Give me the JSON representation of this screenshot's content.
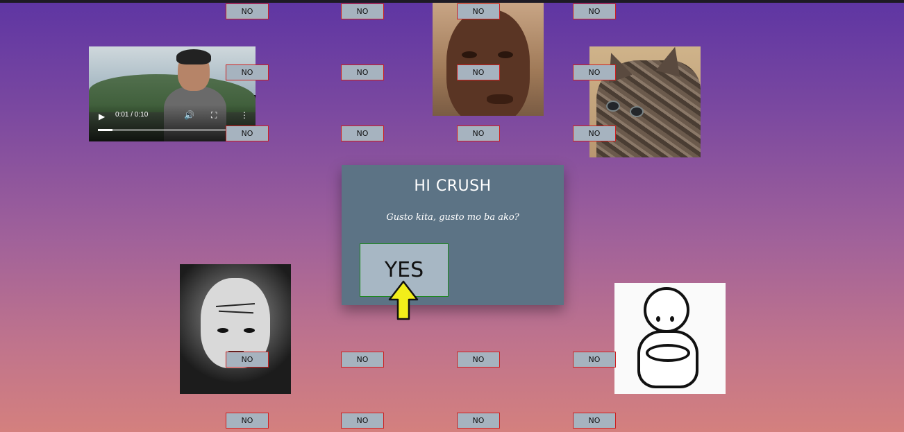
{
  "dialog": {
    "title": "HI CRUSH",
    "subtitle": "Gusto kita, gusto mo ba ako?",
    "yes_label": "YES"
  },
  "no_buttons": [
    {
      "label": "NO"
    },
    {
      "label": "NO"
    },
    {
      "label": "NO"
    },
    {
      "label": "NO"
    },
    {
      "label": "NO"
    },
    {
      "label": "NO"
    },
    {
      "label": "NO"
    },
    {
      "label": "NO"
    },
    {
      "label": "NO"
    },
    {
      "label": "NO"
    },
    {
      "label": "NO"
    },
    {
      "label": "NO"
    },
    {
      "label": "NO"
    },
    {
      "label": "NO"
    },
    {
      "label": "NO"
    },
    {
      "label": "NO"
    },
    {
      "label": "NO"
    },
    {
      "label": "NO"
    },
    {
      "label": "NO"
    },
    {
      "label": "NO"
    }
  ],
  "video": {
    "time_display": "0:01 / 0:10",
    "progress": 0.1
  },
  "colors": {
    "background_top": "#5e35a3",
    "background_bottom": "#d4807e",
    "card": "#5c7385",
    "button_fill": "#a6b3bf",
    "no_border": "#cc1f1f",
    "yes_border": "#1b8a1b",
    "cursor": "#f2ee1a"
  },
  "icons": {
    "cursor": "yellow-arrow-cursor-icon",
    "play": "play-icon",
    "volume": "volume-icon",
    "fullscreen": "fullscreen-icon",
    "more": "more-vert-icon"
  }
}
